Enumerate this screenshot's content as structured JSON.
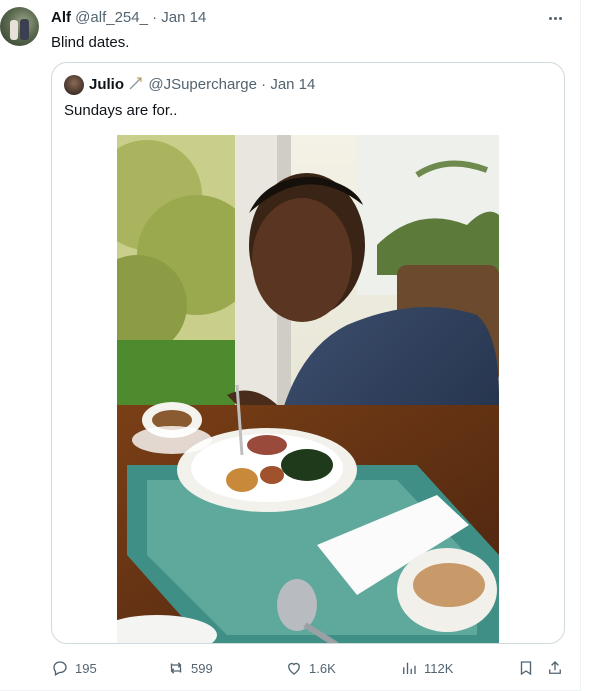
{
  "tweet": {
    "author_name": "Alf",
    "author_handle": "@alf_254_",
    "separator": "·",
    "date": "Jan 14",
    "text": "Blind dates."
  },
  "quoted_tweet": {
    "author_name": "Julio",
    "author_handle": "@JSupercharge",
    "separator": "·",
    "date": "Jan 14",
    "text": "Sundays are for.."
  },
  "actions": {
    "replies": "195",
    "retweets": "599",
    "likes": "1.6K",
    "views": "112K"
  },
  "icons": {
    "more": "more-horizontal-icon",
    "reply": "reply-icon",
    "retweet": "retweet-icon",
    "like": "heart-icon",
    "views": "views-icon",
    "bookmark": "bookmark-icon",
    "share": "share-icon",
    "verified": "badge-icon"
  },
  "colors": {
    "text": "#0f1419",
    "secondary": "#536471",
    "border": "#cfd9de"
  }
}
